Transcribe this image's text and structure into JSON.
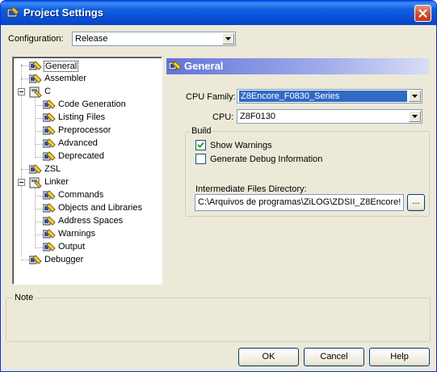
{
  "window": {
    "title": "Project Settings"
  },
  "configuration": {
    "label": "Configuration:",
    "value": "Release"
  },
  "tree": {
    "items": [
      {
        "label": "General",
        "level": 1
      },
      {
        "label": "Assembler",
        "level": 1
      },
      {
        "label": "C",
        "level": 1
      },
      {
        "label": "Code Generation",
        "level": 2
      },
      {
        "label": "Listing Files",
        "level": 2
      },
      {
        "label": "Preprocessor",
        "level": 2
      },
      {
        "label": "Advanced",
        "level": 2
      },
      {
        "label": "Deprecated",
        "level": 2
      },
      {
        "label": "ZSL",
        "level": 1
      },
      {
        "label": "Linker",
        "level": 1
      },
      {
        "label": "Commands",
        "level": 2
      },
      {
        "label": "Objects and Libraries",
        "level": 2
      },
      {
        "label": "Address Spaces",
        "level": 2
      },
      {
        "label": "Warnings",
        "level": 2
      },
      {
        "label": "Output",
        "level": 2
      },
      {
        "label": "Debugger",
        "level": 1
      }
    ],
    "selected": "General"
  },
  "panel": {
    "header": "General",
    "cpu_family_label": "CPU Family:",
    "cpu_family_value": "Z8Encore_F0830_Series",
    "cpu_label": "CPU:",
    "cpu_value": "Z8F0130",
    "build": {
      "caption": "Build",
      "show_warnings_label": "Show Warnings",
      "show_warnings_checked": true,
      "debug_info_label": "Generate Debug Information",
      "debug_info_checked": false,
      "intermediate_label": "Intermediate Files Directory:",
      "intermediate_value": "C:\\Arquivos de programas\\ZiLOG\\ZDSII_Z8Encore!",
      "browse_label": "..."
    }
  },
  "note": {
    "caption": "Note"
  },
  "buttons": {
    "ok": "OK",
    "cancel": "Cancel",
    "help": "Help"
  },
  "colors": {
    "titlebar": "#0a4fd4",
    "selection": "#316ac5",
    "dialog_bg": "#ece9d8"
  }
}
